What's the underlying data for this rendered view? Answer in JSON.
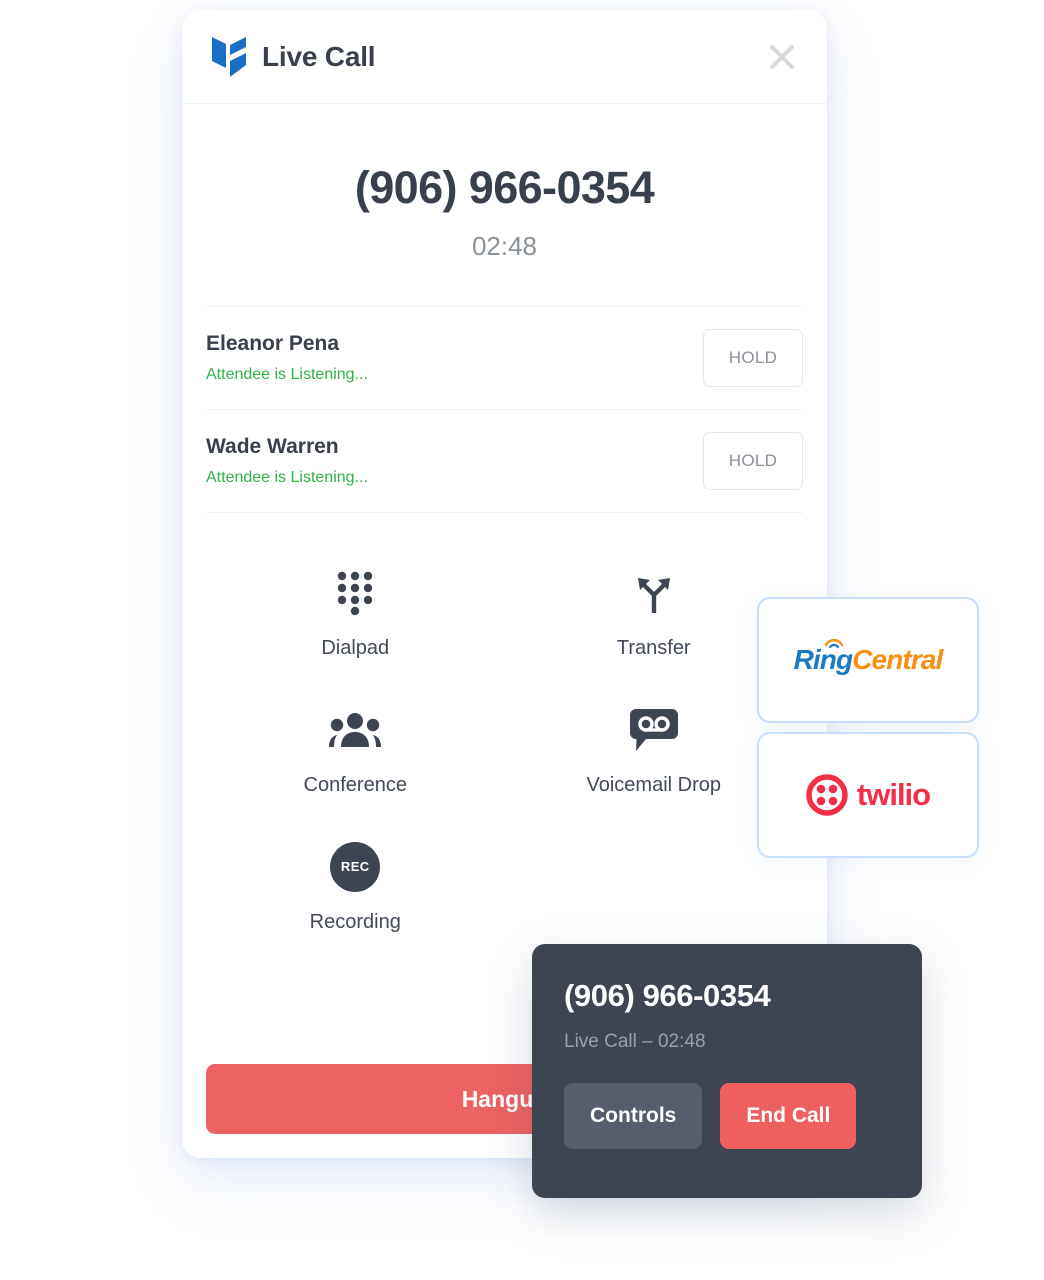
{
  "app": {
    "header": {
      "title": "Live Call",
      "logo_icon": "leaf-logo-icon",
      "logo_color": "#1a6fc4",
      "close_icon": "close-icon"
    },
    "call": {
      "phone_number": "(906) 966-0354",
      "duration": "02:48"
    },
    "attendees": [
      {
        "name": "Eleanor Pena",
        "status": "Attendee is Listening...",
        "action_label": "HOLD"
      },
      {
        "name": "Wade Warren",
        "status": "Attendee is Listening...",
        "action_label": "HOLD"
      }
    ],
    "actions": [
      {
        "label": "Dialpad",
        "icon": "dialpad-icon"
      },
      {
        "label": "Transfer",
        "icon": "transfer-icon"
      },
      {
        "label": "Conference",
        "icon": "conference-icon"
      },
      {
        "label": "Voicemail Drop",
        "icon": "voicemail-icon"
      },
      {
        "label": "Recording",
        "icon": "record-icon",
        "icon_text": "REC"
      }
    ],
    "hangup_label": "Hangup"
  },
  "providers": [
    {
      "name": "RingCentral",
      "part_one": "Ring",
      "part_two": "Central",
      "color_one": "#1a7ac4",
      "color_two": "#f79010"
    },
    {
      "name": "twilio",
      "wordmark": "twilio",
      "color": "#f22f46"
    }
  ],
  "overlay": {
    "phone_number": "(906) 966-0354",
    "subtitle": "Live Call – 02:48",
    "controls_label": "Controls",
    "end_call_label": "End Call",
    "end_call_color": "#ef5f5f"
  },
  "theme": {
    "text_dark": "#39404d",
    "text_muted": "#8b9199",
    "status_green": "#2fb344",
    "danger": "#ed6262",
    "provider_border": "#c7dffb"
  }
}
